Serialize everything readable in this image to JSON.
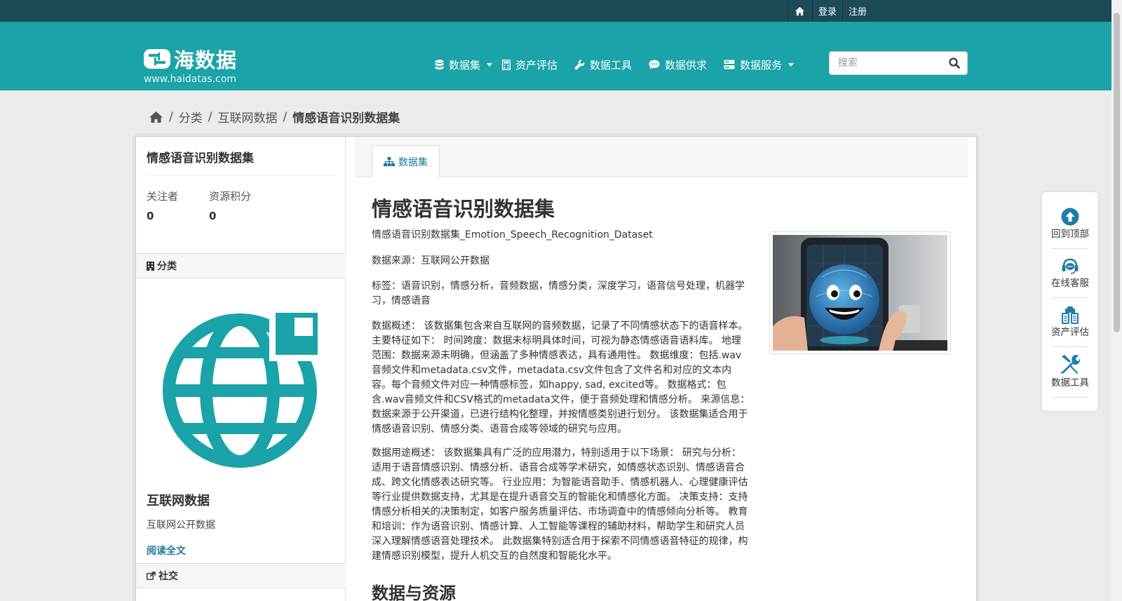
{
  "topbar": {
    "login": "登录",
    "register": "注册"
  },
  "site": {
    "name": "海数据",
    "url": "www.haidatas.com"
  },
  "nav": {
    "datasets": "数据集",
    "asset_eval": "资产评估",
    "data_tools": "数据工具",
    "supply_demand": "数据供求",
    "data_services": "数据服务"
  },
  "search": {
    "placeholder": "搜索"
  },
  "breadcrumb": {
    "category": "分类",
    "parent": "互联网数据",
    "current": "情感语音识别数据集"
  },
  "sidebar": {
    "title": "情感语音识别数据集",
    "followers_label": "关注者",
    "followers_value": "0",
    "points_label": "资源积分",
    "points_value": "0",
    "category_heading": "分类",
    "category_name": "互联网数据",
    "category_desc": "互联网公开数据",
    "read_more": "阅读全文",
    "social_heading": "社交"
  },
  "tabs": {
    "dataset": "数据集"
  },
  "content": {
    "title": "情感语音识别数据集",
    "subtitle": "情感语音识别数据集_Emotion_Speech_Recognition_Dataset",
    "source": "数据来源：互联网公开数据",
    "tags": "标签：语音识别，情感分析，音频数据，情感分类，深度学习，语音信号处理，机器学习，情感语音",
    "overview": "数据概述： 该数据集包含来自互联网的音频数据，记录了不同情感状态下的语音样本。主要特征如下： 时间跨度：数据未标明具体时间，可视为静态情感语音语料库。 地理范围：数据来源未明确，但涵盖了多种情感表达，具有通用性。 数据维度：包括.wav音频文件和metadata.csv文件，metadata.csv文件包含了文件名和对应的文本内容。每个音频文件对应一种情感标签，如happy, sad, excited等。 数据格式：包含.wav音频文件和CSV格式的metadata文件，便于音频处理和情感分析。 来源信息：数据来源于公开渠道，已进行结构化整理，并按情感类别进行划分。 该数据集适合用于情感语音识别、情感分类、语音合成等领域的研究与应用。",
    "usage": "数据用途概述： 该数据集具有广泛的应用潜力，特别适用于以下场景： 研究与分析：适用于语音情感识别、情感分析、语音合成等学术研究，如情感状态识别、情感语音合成、跨文化情感表达研究等。 行业应用：为智能语音助手、情感机器人、心理健康评估等行业提供数据支持，尤其是在提升语音交互的智能化和情感化方面。 决策支持：支持情感分析相关的决策制定，如客户服务质量评估、市场调查中的情感倾向分析等。 教育和培训：作为语音识别、情感计算、人工智能等课程的辅助材料，帮助学生和研究人员深入理解情感语音处理技术。 此数据集特别适合用于探索不同情感语音特征的规律，构建情感识别模型，提升人机交互的自然度和智能化水平。",
    "section_title": "数据与资源"
  },
  "float_panel": {
    "back_to_top": "回到顶部",
    "online_service": "在线客服",
    "asset_eval": "资产评估",
    "data_tools": "数据工具"
  },
  "colors": {
    "teal": "#1aa3a8",
    "topbar": "#1c4a57",
    "link": "#1f7a9c"
  }
}
